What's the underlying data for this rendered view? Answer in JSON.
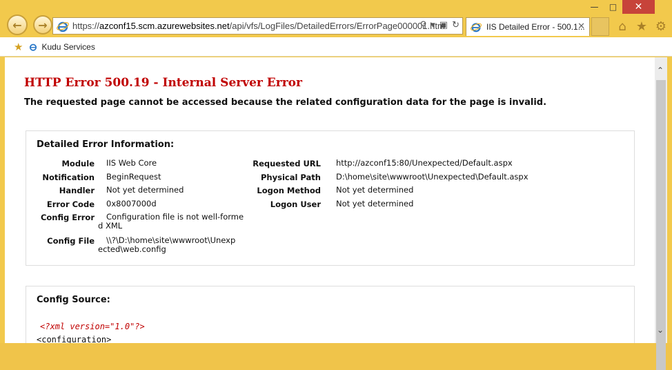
{
  "browser": {
    "url_prefix": "https://",
    "url_host": "azconf15.scm.azurewebsites.net",
    "url_path": "/api/vfs/LogFiles/DetailedErrors/ErrorPage000001.htm",
    "tab_title": "IIS Detailed Error - 500.1...",
    "favorites": [
      {
        "label": "Kudu Services"
      }
    ]
  },
  "page": {
    "title": "HTTP Error 500.19 - Internal Server Error",
    "subtitle": "The requested page cannot be accessed because the related configuration data for the page is invalid.",
    "detail_heading": "Detailed Error Information:",
    "left_fields": [
      {
        "label": "Module",
        "value": "IIS Web Core"
      },
      {
        "label": "Notification",
        "value": "BeginRequest"
      },
      {
        "label": "Handler",
        "value": "Not yet determined"
      },
      {
        "label": "Error Code",
        "value": "0x8007000d"
      },
      {
        "label": "Config Error",
        "value": "Configuration file is not well-forme",
        "value2": "d XML"
      },
      {
        "label": "Config File",
        "value": "\\\\?\\D:\\home\\site\\wwwroot\\Unexp",
        "value2": "ected\\web.config"
      }
    ],
    "right_fields": [
      {
        "label": "Requested URL",
        "value": "http://azconf15:80/Unexpected/Default.aspx"
      },
      {
        "label": "Physical Path",
        "value": "D:\\home\\site\\wwwroot\\Unexpected\\Default.aspx"
      },
      {
        "label": "Logon Method",
        "value": "Not yet determined"
      },
      {
        "label": "Logon User",
        "value": "Not yet determined"
      }
    ],
    "source_heading": "Config Source:",
    "source_line1": "<?xml version=\"1.0\"?>",
    "source_line2": "<configuration>"
  },
  "colors": {
    "accent": "#c00000",
    "chrome": "#f2c94c"
  }
}
